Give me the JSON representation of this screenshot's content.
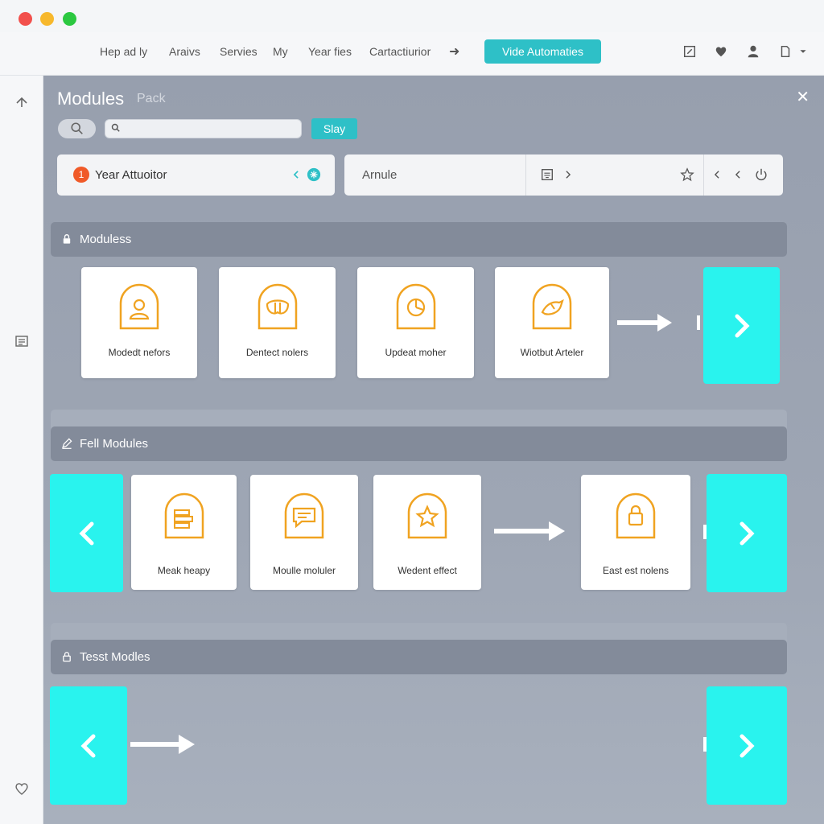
{
  "nav": {
    "items": [
      "Hep ad ly",
      "Araivs",
      "Servies",
      "My",
      "Year fies",
      "Cartactiurior"
    ],
    "cta": "Vide Automaties"
  },
  "main": {
    "title": "Modules",
    "subtitle": "Pack",
    "search_placeholder": "",
    "stay_label": "Slay"
  },
  "cards": {
    "left": {
      "badge": "1",
      "label": "Year Attuoitor"
    },
    "right": {
      "label": "Arnule"
    }
  },
  "sections": [
    {
      "title": "Moduless",
      "modules": [
        "Modedt nefors",
        "Dentect nolers",
        "Updeat moher",
        "Wiotbut Arteler"
      ]
    },
    {
      "title": "Fell Modules",
      "modules": [
        "Meak heapy",
        "Moulle moluler",
        "Wedent effect",
        "East est nolens"
      ]
    },
    {
      "title": "Tesst Modles",
      "modules": []
    }
  ],
  "colors": {
    "accent": "#2ec0c7",
    "tile": "#29f3ee",
    "icon_orange": "#f0a321",
    "panel": "#979fae"
  },
  "icons": {
    "nav": [
      "edit-icon",
      "heart-icon",
      "user-icon",
      "document-icon"
    ],
    "rail": [
      "up-icon",
      "list-icon",
      "heart-outline-icon"
    ],
    "modules": [
      "user-icon",
      "mask-icon",
      "pie-chart-icon",
      "bird-icon",
      "stack-icon",
      "chat-icon",
      "star-icon",
      "lock-icon"
    ]
  }
}
